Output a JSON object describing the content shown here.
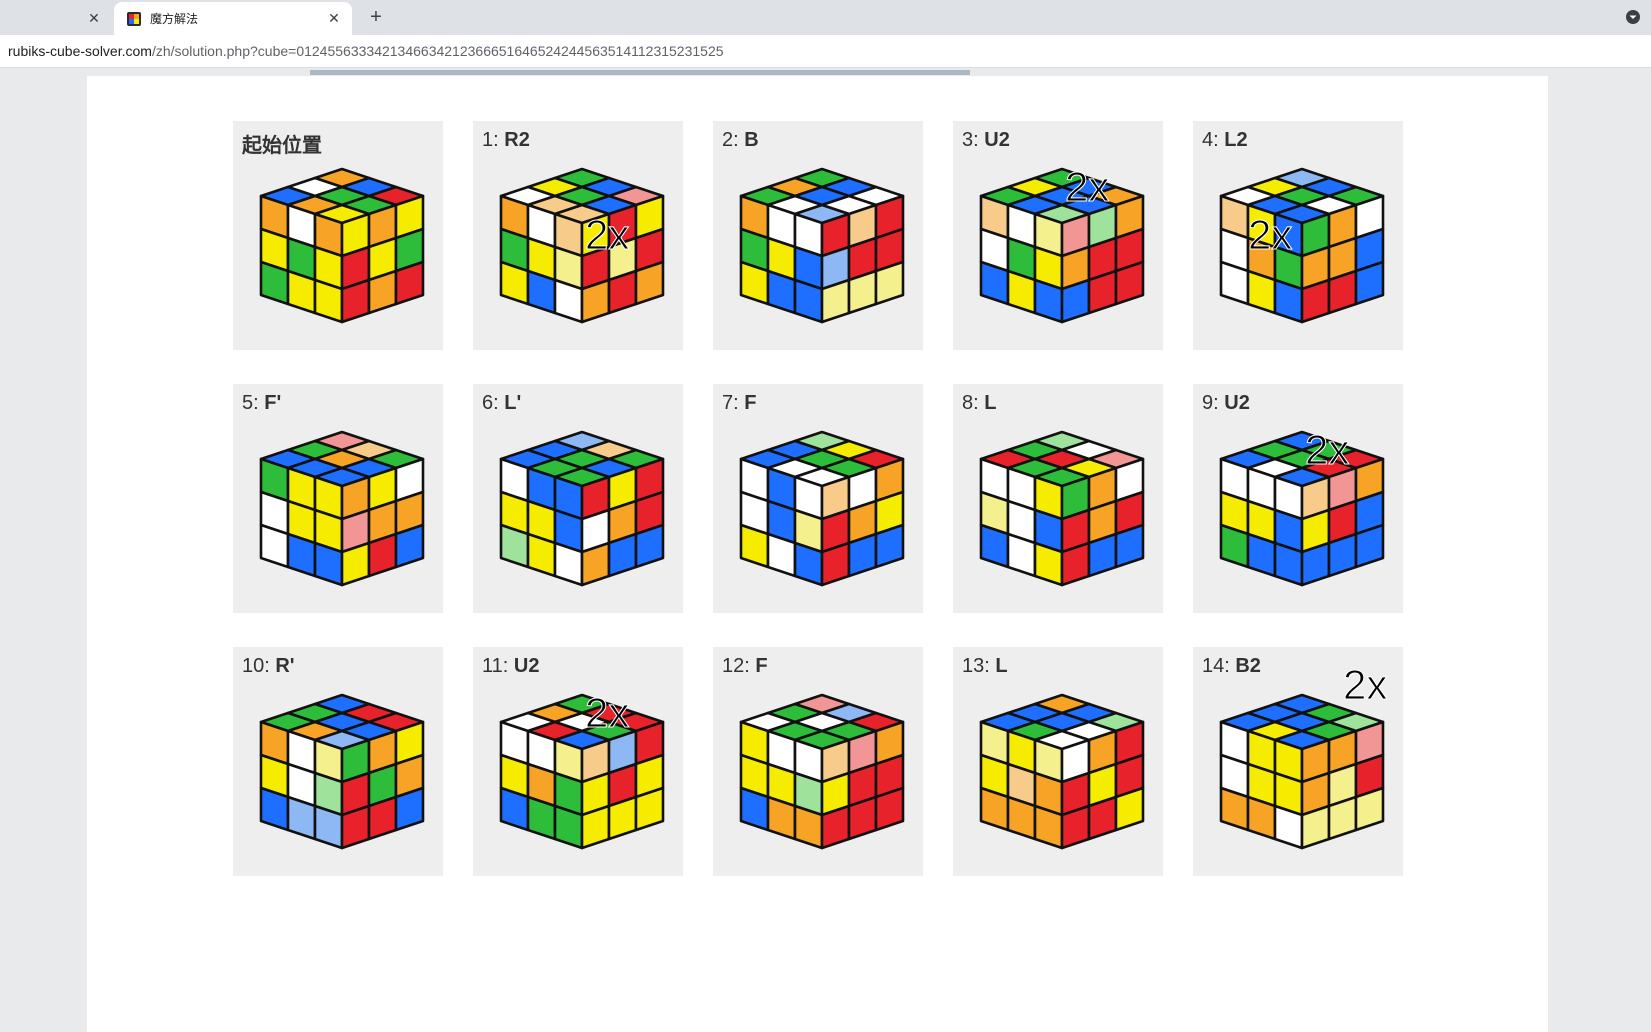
{
  "browser": {
    "tabs": [
      {
        "title": "",
        "active": false
      },
      {
        "title": "魔方解法",
        "active": true
      }
    ],
    "url_domain": "rubiks-cube-solver.com",
    "url_path": "/zh/solution.php?cube=0124556333421346634212366651646524244563514112315231525"
  },
  "colors": {
    "W": "#ffffff",
    "Y": "#f5ec00",
    "B": "#1e6fff",
    "G": "#2ebd3a",
    "R": "#e8222a",
    "O": "#f7a325",
    "LY": "#f5f08e",
    "LB": "#8db8f3",
    "LG": "#9ee29c",
    "LR": "#f29595",
    "LO": "#f7cc8a"
  },
  "steps": [
    {
      "num": "",
      "move": "起始位置",
      "double": false,
      "faces": {
        "top": "OBRWGGBOY",
        "front": "OWOYGYGYYBWB",
        "right": "YOYRYGRORRRR"
      }
    },
    {
      "num": "1: ",
      "move": "R2",
      "double": true,
      "faces": {
        "top": "GBLRYGBWLO",
        "front": "OWLOGYLYYBW",
        "right": "YRYRLYROROOR"
      }
    },
    {
      "num": "2: ",
      "move": "B",
      "double": false,
      "faces": {
        "top": "GBWOBWGWLB",
        "front": "OWWGYBYBB",
        "right": "RLORLBRRLYLY"
      }
    },
    {
      "num": "3: ",
      "move": "U2",
      "double": true,
      "faces": {
        "top": "GBOYBBGBLG",
        "front": "LOWLYWGYBYBB",
        "right": "LRLGOORRBRRB"
      }
    },
    {
      "num": "4: ",
      "move": "L2",
      "double": true,
      "faces": {
        "top": "LBBGYGWWBB",
        "front": "LOYBWOGWYBBR",
        "right": "GOWOOBRRB"
      }
    },
    {
      "num": "5: ",
      "move": "F'",
      "double": false,
      "faces": {
        "top": "LRLOGGOBBB",
        "front": "GYYWYYWBBWBB",
        "right": "OYWLROOYRB"
      }
    },
    {
      "num": "6: ",
      "move": "L'",
      "double": false,
      "faces": {
        "top": "LBLOGBGBBG",
        "front": "WBBYYBLGYWW",
        "right": "RYRWOROB"
      }
    },
    {
      "num": "7: ",
      "move": "F",
      "double": false,
      "faces": {
        "top": "LGYRBGGBW",
        "front": "WBWWBLYYWB",
        "right": "LOWOROYRB"
      }
    },
    {
      "num": "8: ",
      "move": "L",
      "double": false,
      "faces": {
        "top": "LGWLRGRYRG",
        "front": "LWYLYWBBWY",
        "right": "GOWRORRB"
      }
    },
    {
      "num": "9: ",
      "move": "U2",
      "double": true,
      "faces": {
        "top": "BGRGGRBWBG",
        "front": "WWWYYBGBB",
        "right": "LOLROYRB"
      }
    },
    {
      "num": "10: ",
      "move": "R'",
      "double": false,
      "faces": {
        "top": "BRRGBBGOLB",
        "front": "OWLYYLLGBLB",
        "right": "GOYRGORRB"
      }
    },
    {
      "num": "11: ",
      "move": "U2",
      "double": true,
      "faces": {
        "top": "GRROWGWRBB",
        "front": "LWLYYOGBG",
        "right": "LOLBRYRY"
      }
    },
    {
      "num": "12: ",
      "move": "F",
      "double": false,
      "faces": {
        "top": "LRLBRGWGWG",
        "front": "YWWYYLGBO",
        "right": "LOLROYRR"
      }
    },
    {
      "num": "13: ",
      "move": "L",
      "double": false,
      "faces": {
        "top": "OBLGBBWBGW",
        "front": "LYYLYYLOO",
        "right": "WORRYRRRY"
      }
    },
    {
      "num": "14: ",
      "move": "B2",
      "double": true,
      "faces": {
        "top": "BGLGBBGBYB",
        "front": "WYYWYYOOW",
        "right": "OOLROLYRLY"
      }
    }
  ]
}
